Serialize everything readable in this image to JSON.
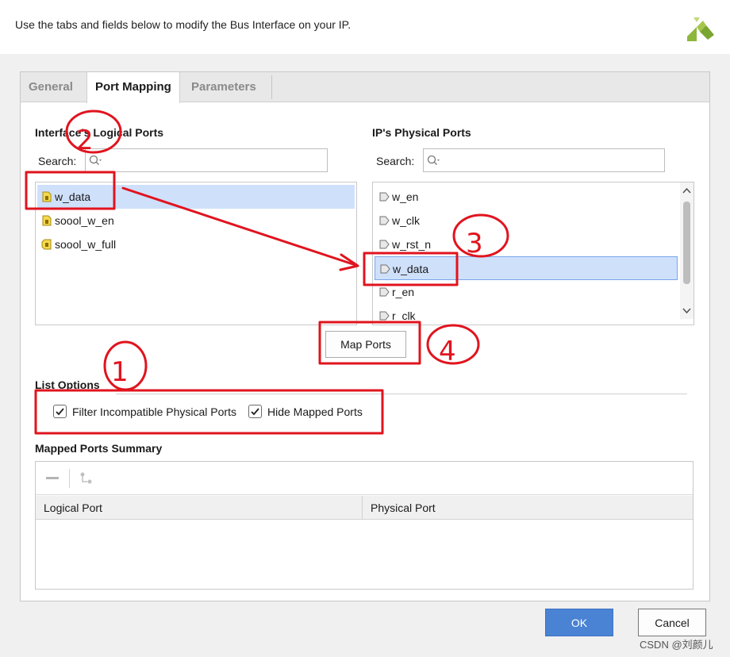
{
  "header": {
    "instruction": "Use the tabs and fields below to modify the Bus Interface on your IP."
  },
  "tabs": [
    {
      "label": "General",
      "active": false
    },
    {
      "label": "Port Mapping",
      "active": true
    },
    {
      "label": "Parameters",
      "active": false
    }
  ],
  "logical_ports": {
    "title": "Interface's Logical Ports",
    "search_label": "Search:",
    "search_value": "",
    "items": [
      {
        "label": "w_data",
        "selected": true,
        "icon": "port-in-icon"
      },
      {
        "label": "soool_w_en",
        "selected": false,
        "icon": "port-in-icon"
      },
      {
        "label": "soool_w_full",
        "selected": false,
        "icon": "port-out-icon"
      }
    ]
  },
  "physical_ports": {
    "title": "IP's Physical Ports",
    "search_label": "Search:",
    "search_value": "",
    "items": [
      {
        "label": "w_en",
        "selected": false
      },
      {
        "label": "w_clk",
        "selected": false
      },
      {
        "label": "w_rst_n",
        "selected": false
      },
      {
        "label": "w_data",
        "selected": true
      },
      {
        "label": "r_en",
        "selected": false
      },
      {
        "label": "r_clk",
        "selected": false
      }
    ]
  },
  "map_ports_label": "Map Ports",
  "list_options": {
    "title": "List Options",
    "filter_incompatible": {
      "label": "Filter Incompatible Physical Ports",
      "checked": true
    },
    "hide_mapped": {
      "label": "Hide Mapped Ports",
      "checked": true
    }
  },
  "mapped_summary": {
    "title": "Mapped Ports Summary",
    "columns": [
      "Logical Port",
      "Physical Port"
    ],
    "rows": []
  },
  "buttons": {
    "ok": "OK",
    "cancel": "Cancel"
  },
  "annotations": [
    "1",
    "2",
    "3",
    "4"
  ],
  "watermark": "CSDN @刘颜儿",
  "colors": {
    "selection": "#cfe0fb",
    "primary_button": "#4a82d4",
    "annotation_red": "#e0141e",
    "logo_green": "#8db63c"
  }
}
